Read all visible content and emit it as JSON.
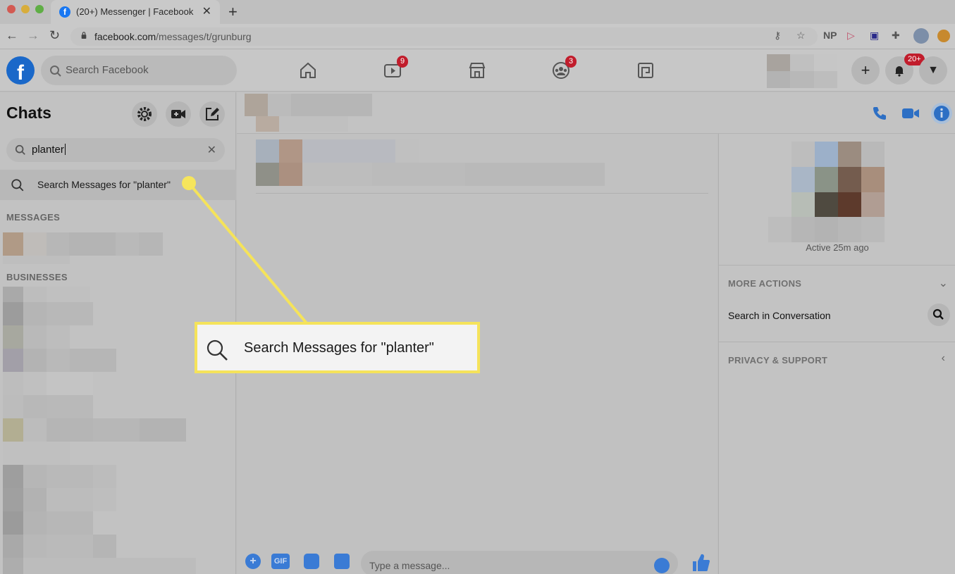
{
  "browser": {
    "tab_title": "(20+) Messenger | Facebook",
    "tab_favicon": "f",
    "url_host": "facebook.com",
    "url_path": "/messages/t/grunburg",
    "extension_np": "NP"
  },
  "fb_header": {
    "logo": "f",
    "search_placeholder": "Search Facebook",
    "watch_badge": "9",
    "groups_badge": "3",
    "notifications_badge": "20+"
  },
  "chats": {
    "title": "Chats",
    "search_value": "planter",
    "search_messages_label": "Search Messages for \"planter\"",
    "section_messages": "MESSAGES",
    "section_businesses": "BUSINESSES"
  },
  "conversation": {
    "composer_placeholder": "Type a message...",
    "gif_label": "GIF"
  },
  "info_panel": {
    "active_status": "Active 25m ago",
    "more_actions": "MORE ACTIONS",
    "search_in_conversation": "Search in Conversation",
    "privacy_support": "PRIVACY & SUPPORT"
  },
  "callout": {
    "text": "Search Messages for \"planter\""
  },
  "colors": {
    "accent_blue": "#1877f2",
    "badge_red": "#c11d2c",
    "highlight_yellow": "#f5e35a"
  }
}
